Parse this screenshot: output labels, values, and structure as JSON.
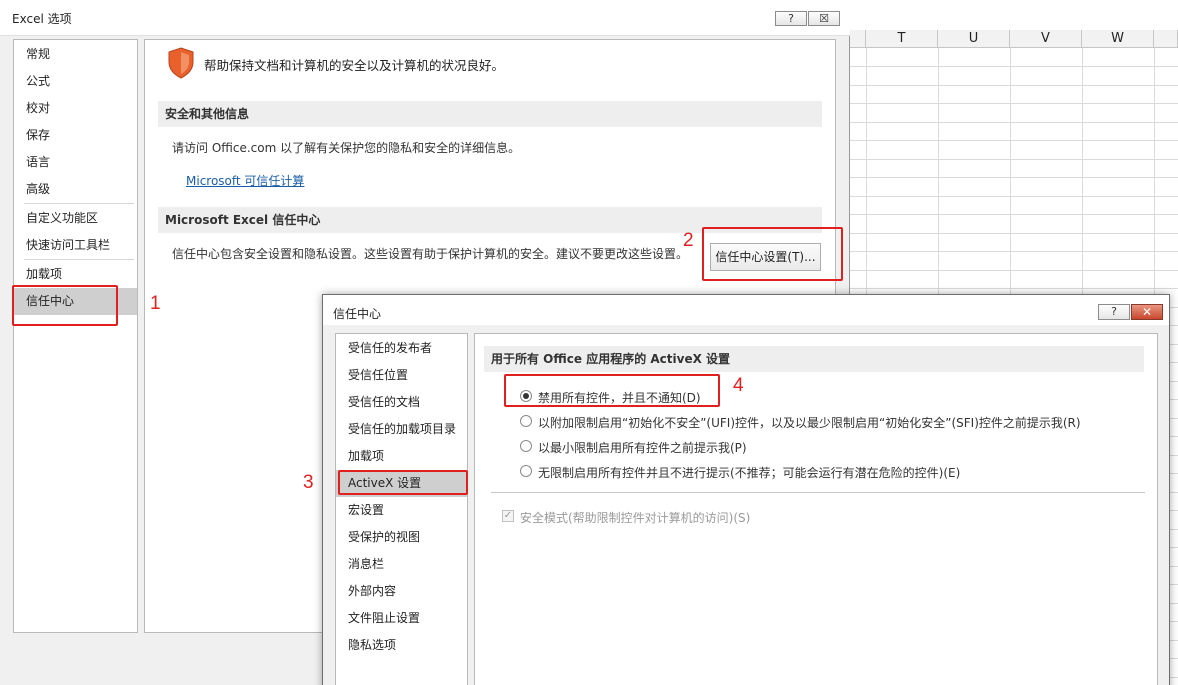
{
  "sheet": {
    "columns": [
      "T",
      "U",
      "V",
      "W"
    ]
  },
  "options_dialog": {
    "title": "Excel 选项",
    "help_label": "?",
    "close_label": "☒",
    "nav_items": [
      "常规",
      "公式",
      "校对",
      "保存",
      "语言",
      "高级",
      "自定义功能区",
      "快速访问工具栏",
      "加载项",
      "信任中心"
    ],
    "selected_nav": "信任中心",
    "header_text": "帮助保持文档和计算机的安全以及计算机的状况良好。",
    "section_privacy": {
      "title": "安全和其他信息",
      "text": "请访问 Office.com 以了解有关保护您的隐私和安全的详细信息。",
      "link": "Microsoft 可信任计算"
    },
    "section_trust": {
      "title": "Microsoft Excel 信任中心",
      "text": "信任中心包含安全设置和隐私设置。这些设置有助于保护计算机的安全。建议不要更改这些设置。",
      "button": "信任中心设置(T)..."
    }
  },
  "trust_center": {
    "title": "信任中心",
    "help_label": "?",
    "close_label": "✕",
    "nav_items": [
      "受信任的发布者",
      "受信任位置",
      "受信任的文档",
      "受信任的加载项目录",
      "加载项",
      "ActiveX 设置",
      "宏设置",
      "受保护的视图",
      "消息栏",
      "外部内容",
      "文件阻止设置",
      "隐私选项"
    ],
    "selected_nav": "ActiveX 设置",
    "section_title": "用于所有 Office 应用程序的 ActiveX 设置",
    "options": [
      {
        "label": "禁用所有控件，并且不通知(D)",
        "checked": true
      },
      {
        "label": "以附加限制启用“初始化不安全”(UFI)控件，以及以最少限制启用“初始化安全”(SFI)控件之前提示我(R)",
        "checked": false
      },
      {
        "label": "以最小限制启用所有控件之前提示我(P)",
        "checked": false
      },
      {
        "label": "无限制启用所有控件并且不进行提示(不推荐；可能会运行有潜在危险的控件)(E)",
        "checked": false
      }
    ],
    "safe_mode": {
      "label": "安全模式(帮助限制控件对计算机的访问)(S)",
      "checked": true,
      "disabled": true
    }
  },
  "annotations": [
    "1",
    "2",
    "3",
    "4"
  ],
  "colors": {
    "annotation": "#e02020",
    "shield": "#e8612c",
    "link": "#1a5da8",
    "selected_nav": "#cfcfcf"
  }
}
